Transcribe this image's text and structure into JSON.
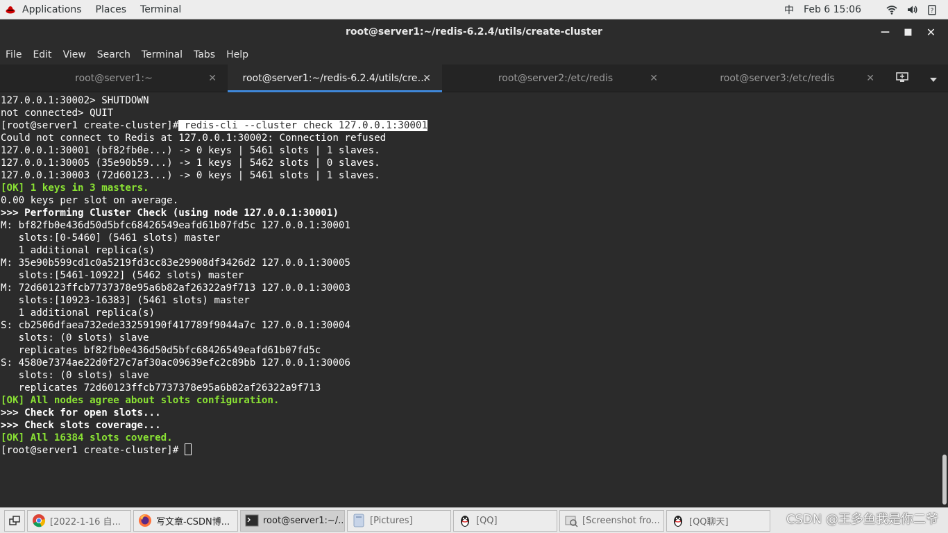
{
  "topbar": {
    "applications": "Applications",
    "places": "Places",
    "terminal": "Terminal",
    "input_method": "中",
    "datetime": "Feb 6  15:06"
  },
  "window": {
    "title": "root@server1:~/redis-6.2.4/utils/create-cluster"
  },
  "menu": [
    "File",
    "Edit",
    "View",
    "Search",
    "Terminal",
    "Tabs",
    "Help"
  ],
  "tabs": [
    {
      "label": "root@server1:~"
    },
    {
      "label": "root@server1:~/redis-6.2.4/utils/cre…"
    },
    {
      "label": "root@server2:/etc/redis"
    },
    {
      "label": "root@server3:/etc/redis"
    }
  ],
  "terminal": {
    "prompt1": "[root@server1 create-cluster]#",
    "command1": " redis-cli --cluster check 127.0.0.1:30001",
    "lines": [
      "127.0.0.1:30002> SHUTDOWN",
      "not connected> QUIT",
      "Could not connect to Redis at 127.0.0.1:30002: Connection refused",
      "127.0.0.1:30001 (bf82fb0e...) -> 0 keys | 5461 slots | 1 slaves.",
      "127.0.0.1:30005 (35e90b59...) -> 1 keys | 5462 slots | 0 slaves.",
      "127.0.0.1:30003 (72d60123...) -> 0 keys | 5461 slots | 1 slaves.",
      "[OK] 1 keys in 3 masters.",
      "0.00 keys per slot on average.",
      ">>> Performing Cluster Check (using node 127.0.0.1:30001)",
      "M: bf82fb0e436d50d5bfc68426549eafd61b07fd5c 127.0.0.1:30001",
      "   slots:[0-5460] (5461 slots) master",
      "   1 additional replica(s)",
      "M: 35e90b599cd1c0a5219fd3cc83e29908df3426d2 127.0.0.1:30005",
      "   slots:[5461-10922] (5462 slots) master",
      "M: 72d60123ffcb7737378e95a6b82af26322a9f713 127.0.0.1:30003",
      "   slots:[10923-16383] (5461 slots) master",
      "   1 additional replica(s)",
      "S: cb2506dfaea732ede33259190f417789f9044a7c 127.0.0.1:30004",
      "   slots: (0 slots) slave",
      "   replicates bf82fb0e436d50d5bfc68426549eafd61b07fd5c",
      "S: 4580e7374ae22d0f27c7af30ac09639efc2c89bb 127.0.0.1:30006",
      "   slots: (0 slots) slave",
      "   replicates 72d60123ffcb7737378e95a6b82af26322a9f713",
      "[OK] All nodes agree about slots configuration.",
      ">>> Check for open slots...",
      ">>> Check slots coverage...",
      "[OK] All 16384 slots covered."
    ],
    "prompt2": "[root@server1 create-cluster]# "
  },
  "taskbar": {
    "items": [
      {
        "label": "[2022-1-16 自..."
      },
      {
        "label": "写文章-CSDN博..."
      },
      {
        "label": "root@server1:~/..."
      },
      {
        "label": "[Pictures]"
      },
      {
        "label": "[QQ]"
      },
      {
        "label": "[Screenshot fro..."
      },
      {
        "label": "[QQ聊天]"
      }
    ],
    "watermark": "CSDN @王多鱼我是你二爷"
  }
}
